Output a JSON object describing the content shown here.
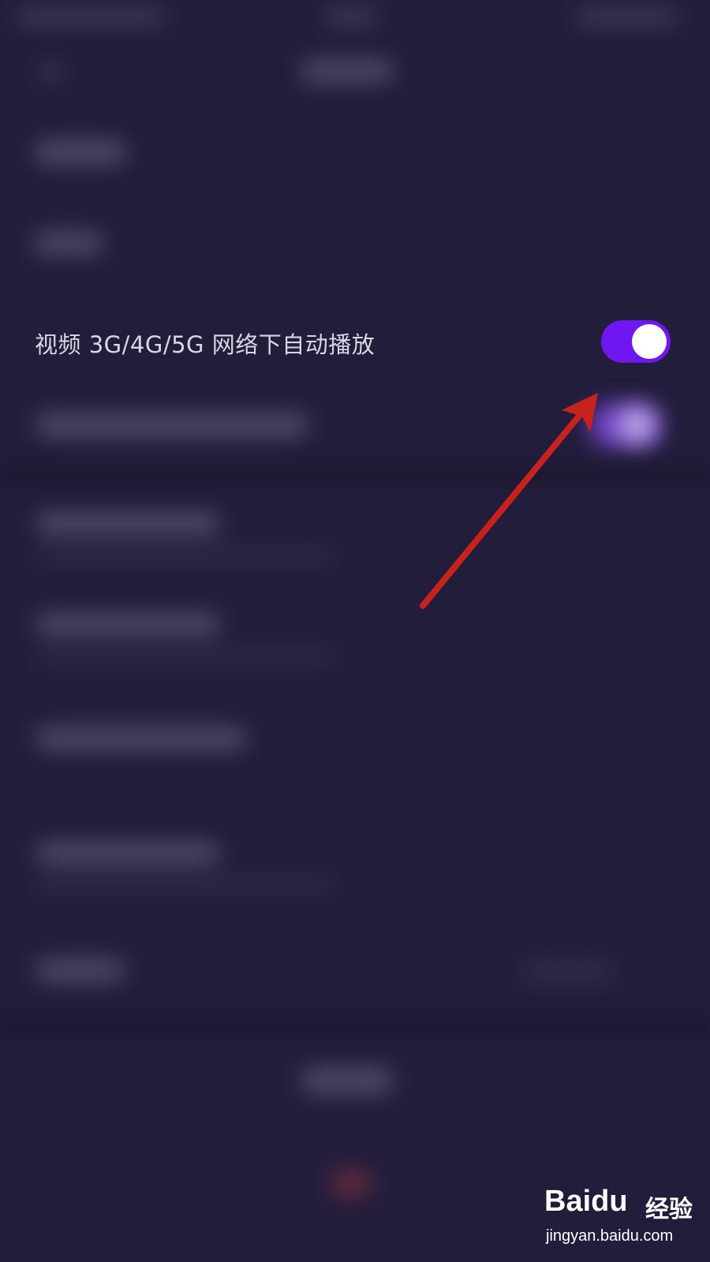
{
  "settings": {
    "autoplay_mobile": {
      "label": "视频 3G/4G/5G 网络下自动播放",
      "enabled": true
    }
  },
  "colors": {
    "background": "#221d3b",
    "toggle_on": "#7016f0",
    "toggle_knob": "#ffffff",
    "annotation_arrow": "#c8221c",
    "label_text": "#d9d7e2"
  },
  "annotation": {
    "type": "arrow",
    "points_to": "autoplay-toggle"
  },
  "watermark": {
    "logo": "Baidu",
    "brand": "经验",
    "url": "jingyan.baidu.com"
  }
}
